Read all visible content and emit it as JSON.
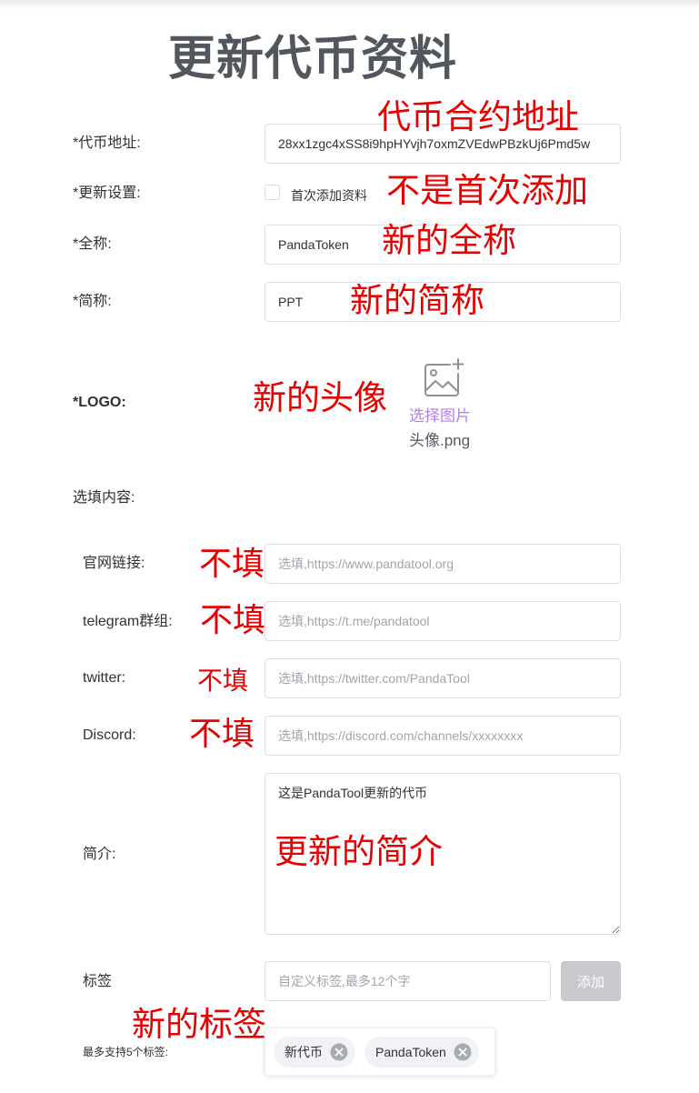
{
  "page_title": "更新代币资料",
  "form": {
    "token_address": {
      "label": "*代币地址:",
      "value": "28xx1zgc4xSS8i9hpHYvjh7oxmZVEdwPBzkUj6Pmd5w"
    },
    "update_setting": {
      "label": "*更新设置:",
      "checkbox_label": "首次添加资料",
      "checked": false
    },
    "full_name": {
      "label": "*全称:",
      "value": "PandaToken"
    },
    "symbol": {
      "label": "*简称:",
      "value": "PPT"
    },
    "logo": {
      "label": "*LOGO:",
      "icon": "image-add-icon",
      "select_label": "选择图片",
      "file_name": "头像.png"
    },
    "optional_section_label": "选填内容:",
    "website": {
      "label": "官网链接:",
      "placeholder": "选填,https://www.pandatool.org"
    },
    "telegram": {
      "label": "telegram群组:",
      "placeholder": "选填,https://t.me/pandatool"
    },
    "twitter": {
      "label": "twitter:",
      "placeholder": "选填,https://twitter.com/PandaTool"
    },
    "discord": {
      "label": "Discord:",
      "placeholder": "选填,https://discord.com/channels/xxxxxxxx"
    },
    "intro": {
      "label": "简介:",
      "value": "这是PandaTool更新的代币"
    },
    "tags": {
      "label": "标签",
      "placeholder": "自定义标签,最多12个字",
      "add_button": "添加",
      "limit_label": "最多支持5个标签:",
      "items": [
        "新代币",
        "PandaToken"
      ],
      "remove_icon": "close-circle-icon"
    }
  },
  "annotations": {
    "token_address": "代币合约地址",
    "update_setting": "不是首次添加",
    "full_name": "新的全称",
    "symbol": "新的简称",
    "logo": "新的头像",
    "website": "不填",
    "telegram": "不填",
    "twitter": "不填",
    "discord": "不填",
    "intro": "更新的简介",
    "tags": "新的标签"
  },
  "colors": {
    "annotation": "#e60000",
    "accent": "#b37feb",
    "title": "#51575d",
    "disabled_button": "#c8c9cc"
  }
}
